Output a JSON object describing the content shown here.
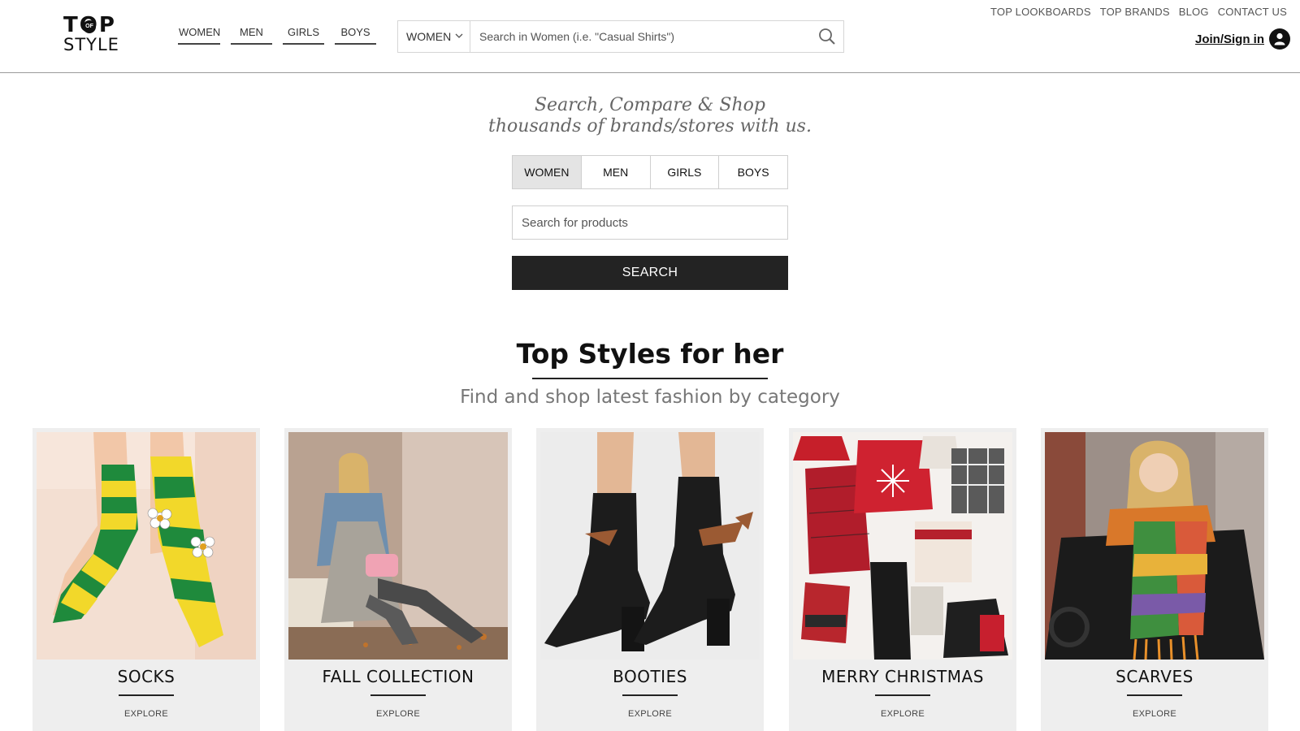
{
  "header": {
    "logo": {
      "line1": "TOP",
      "of": "OF",
      "line2": "STYLE"
    },
    "nav": [
      {
        "label": "WOMEN"
      },
      {
        "label": "MEN"
      },
      {
        "label": "GIRLS"
      },
      {
        "label": "BOYS"
      }
    ],
    "search": {
      "category": "WOMEN",
      "placeholder": "Search in Women (i.e. \"Casual Shirts\")"
    },
    "top_links": [
      {
        "label": "TOP LOOKBOARDS"
      },
      {
        "label": "TOP BRANDS"
      },
      {
        "label": "BLOG"
      },
      {
        "label": "CONTACT US"
      }
    ],
    "account": {
      "label": "Join/Sign in"
    }
  },
  "hero": {
    "line1": "Search, Compare & Shop",
    "line2": "thousands of brands/stores with us.",
    "tabs": [
      {
        "label": "WOMEN",
        "active": true
      },
      {
        "label": "MEN",
        "active": false
      },
      {
        "label": "GIRLS",
        "active": false
      },
      {
        "label": "BOYS",
        "active": false
      }
    ],
    "search_placeholder": "Search for products",
    "search_button": "SEARCH"
  },
  "section": {
    "title": "Top Styles for her",
    "subtitle": "Find and shop latest fashion by category",
    "cards": [
      {
        "label": "SOCKS",
        "explore": "EXPLORE"
      },
      {
        "label": "FALL COLLECTION",
        "explore": "EXPLORE"
      },
      {
        "label": "BOOTIES",
        "explore": "EXPLORE"
      },
      {
        "label": "MERRY CHRISTMAS",
        "explore": "EXPLORE"
      },
      {
        "label": "SCARVES",
        "explore": "EXPLORE"
      }
    ]
  },
  "colors": {
    "dark": "#232323",
    "tab_active": "#e4e4e4",
    "card_bg": "#eeeeee",
    "muted_text": "#777777"
  }
}
